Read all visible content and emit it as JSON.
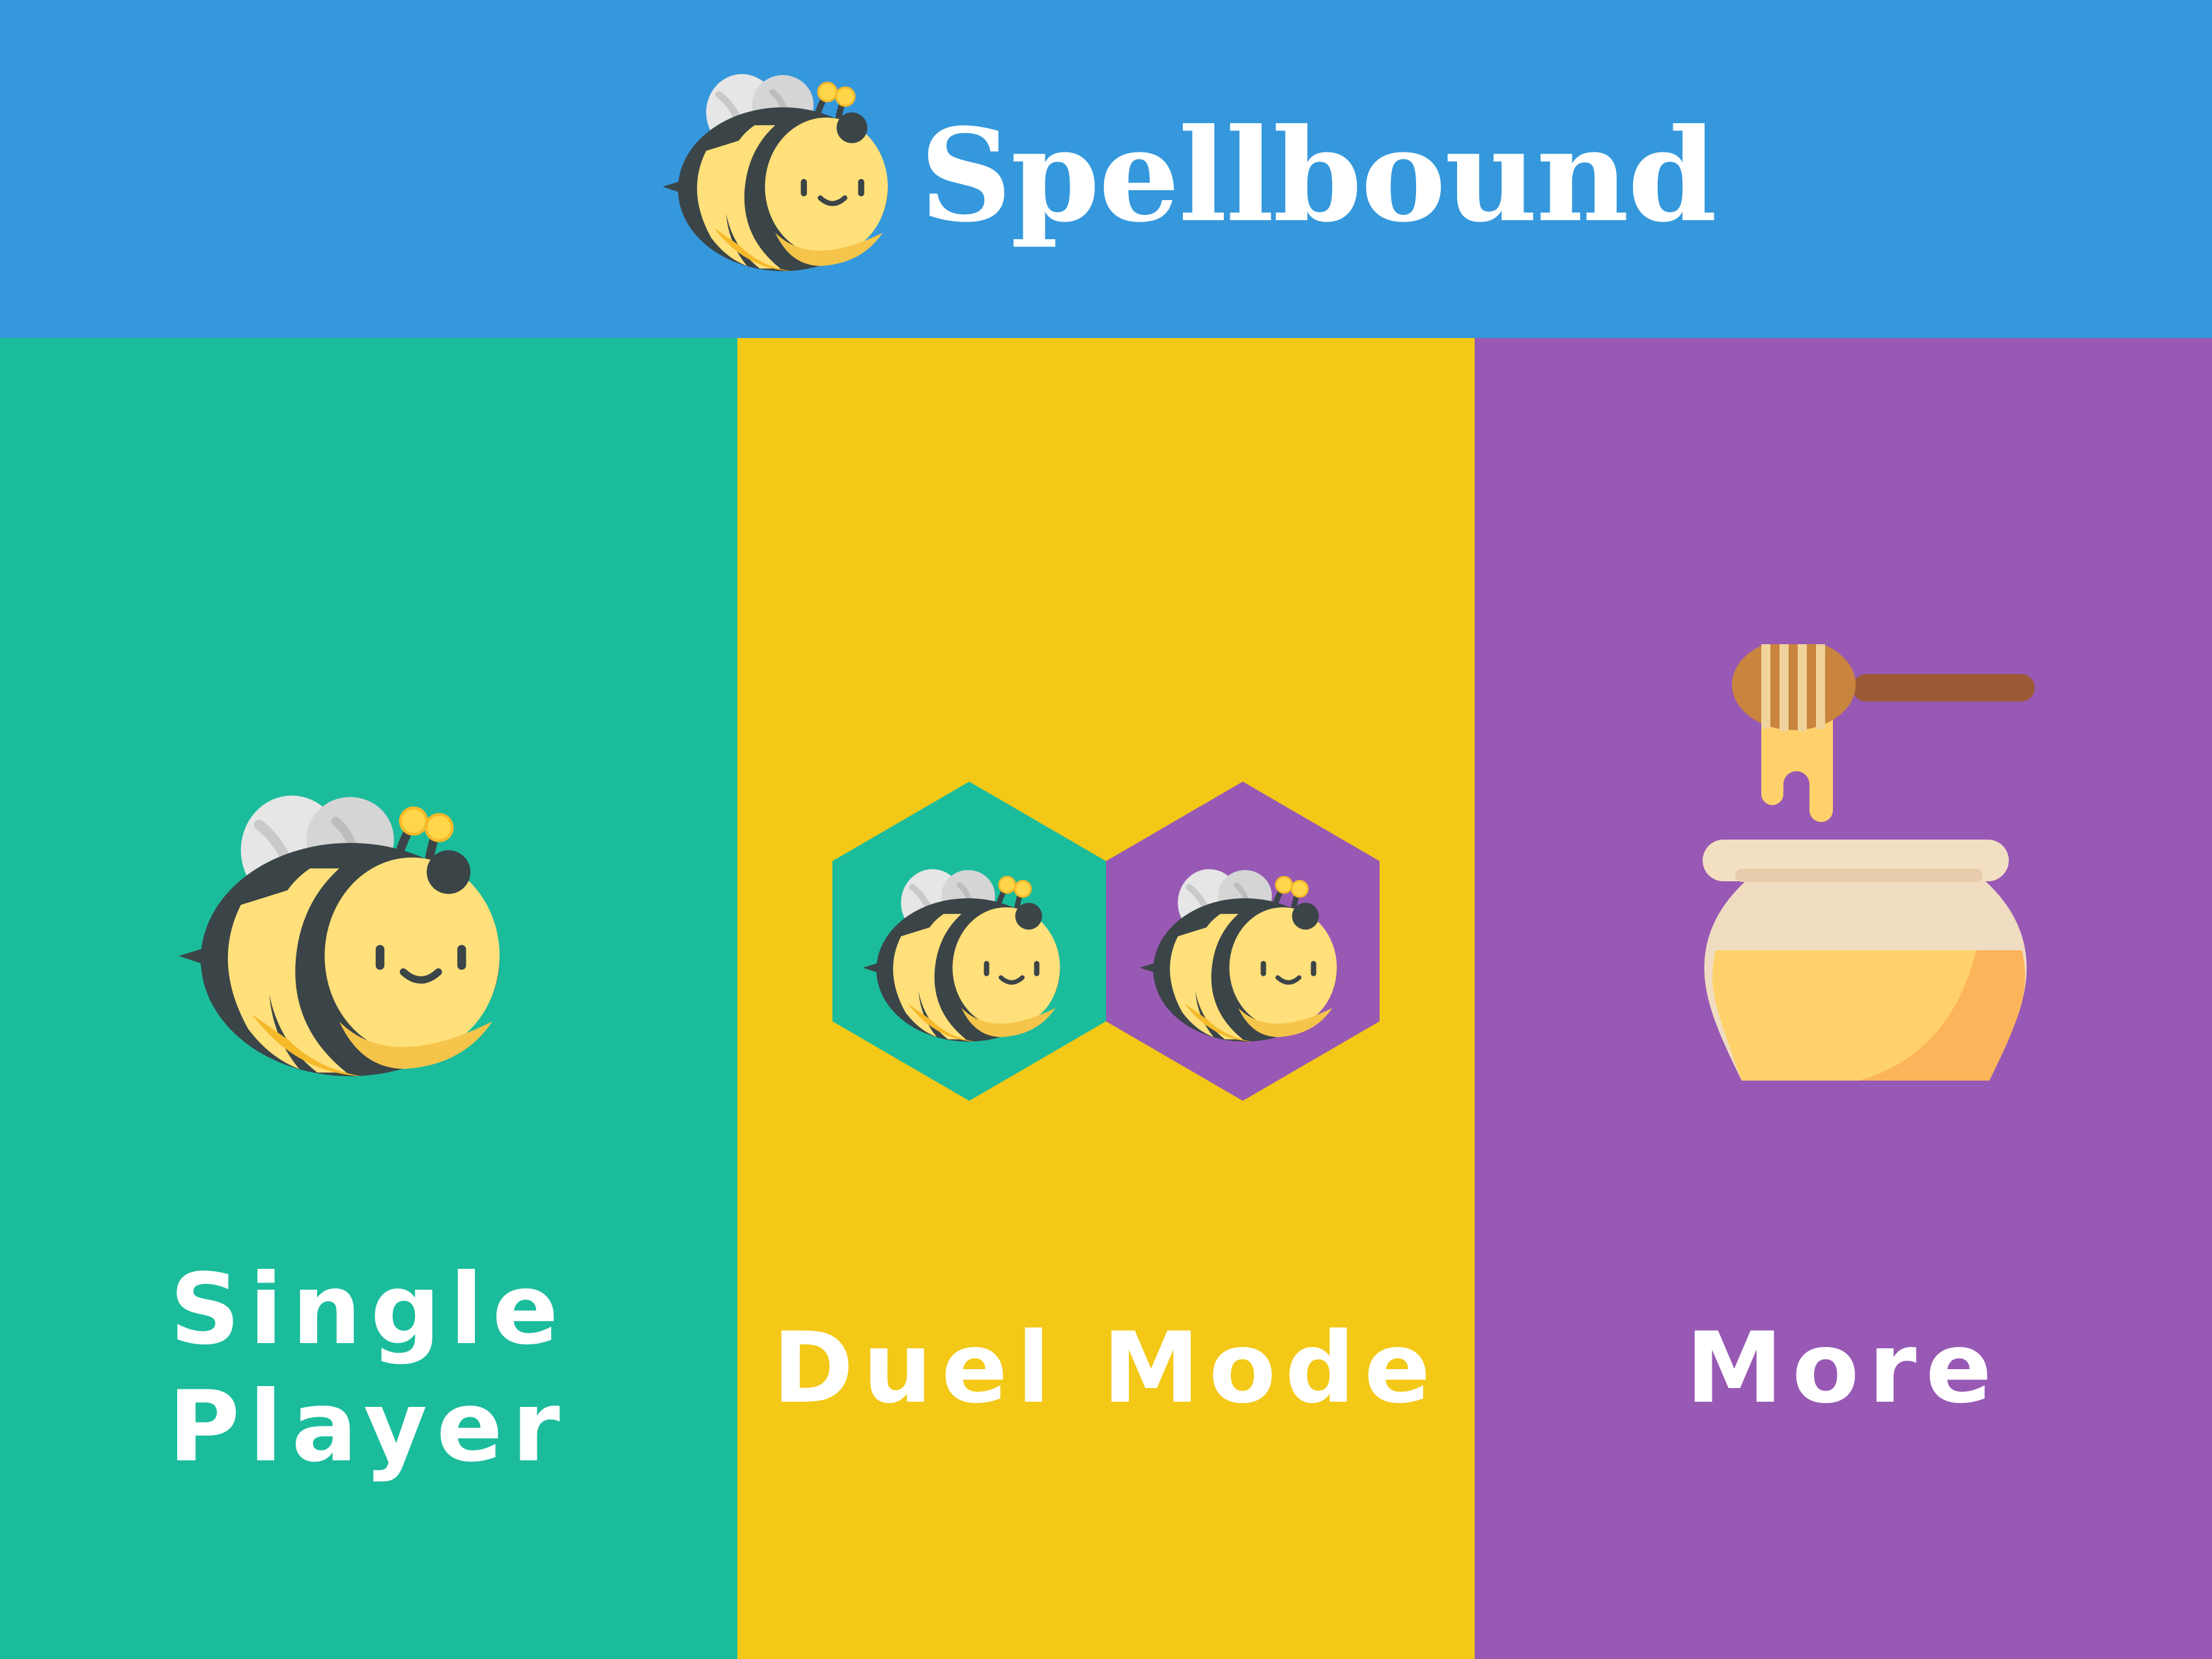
{
  "header": {
    "app_title": "Spellbound",
    "logo_icon": "bee-icon",
    "background_color": "#3598dc"
  },
  "menu": [
    {
      "id": "single",
      "label_line1": "Single",
      "label_line2": "Player",
      "icon": "bee-icon",
      "color": "#1bbc9c"
    },
    {
      "id": "duel",
      "label": "Duel Mode",
      "icon": "two-bees-hexagon-icon",
      "color": "#f3c816"
    },
    {
      "id": "more",
      "label": "More",
      "icon": "honey-pot-icon",
      "color": "#9859b4"
    }
  ]
}
